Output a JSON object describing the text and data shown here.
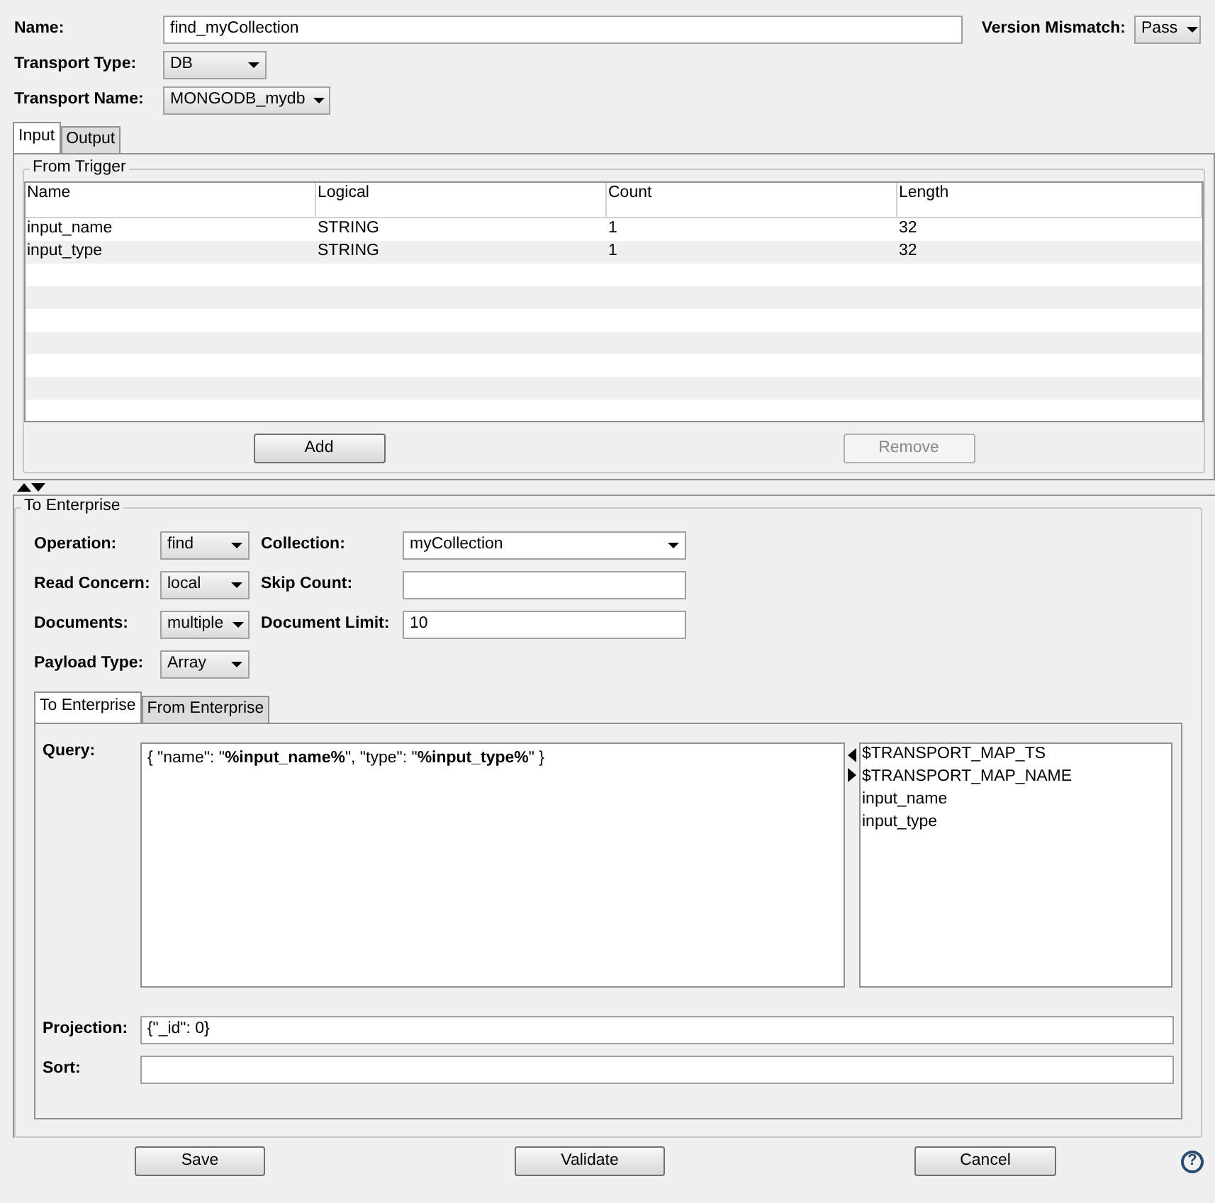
{
  "header_fields": [
    {
      "label": "Name:",
      "kind": "text",
      "value": "find_myCollection"
    },
    {
      "label": "Transport Type:",
      "kind": "dropdown",
      "value": "DB"
    },
    {
      "label": "Transport Name:",
      "kind": "dropdown",
      "value": "MONGODB_mydb"
    }
  ],
  "version_mismatch": {
    "label": "Version Mismatch:",
    "value": "Pass"
  },
  "tabs": [
    {
      "label": "Input",
      "selected": true
    },
    {
      "label": "Output",
      "selected": false
    }
  ],
  "from_trigger": {
    "title": "From Trigger",
    "table": {
      "columns": [
        "Name",
        "Logical",
        "Count",
        "Length"
      ],
      "rows": [
        [
          "input_name",
          "STRING",
          "1",
          "32"
        ],
        [
          "input_type",
          "STRING",
          "1",
          "32"
        ]
      ]
    },
    "buttons": [
      {
        "label": "Add",
        "disabled": false
      },
      {
        "label": "Remove",
        "disabled": true
      }
    ]
  },
  "to_enterprise": {
    "title": "To Enterprise",
    "left_fields": [
      {
        "label": "Operation:",
        "kind": "dropdown",
        "value": "find"
      },
      {
        "label": "Read Concern:",
        "kind": "dropdown",
        "value": "local"
      },
      {
        "label": "Documents:",
        "kind": "dropdown",
        "value": "multiple"
      },
      {
        "label": "Payload Type:",
        "kind": "dropdown",
        "value": "Array"
      }
    ],
    "right_fields": [
      {
        "label": "Collection:",
        "kind": "combo",
        "value": "myCollection"
      },
      {
        "label": "Skip Count:",
        "kind": "text"
      },
      {
        "label": "Document Limit:",
        "kind": "text",
        "value": "10"
      }
    ],
    "tabs": [
      {
        "label": "To Enterprise",
        "selected": true
      },
      {
        "label": "From Enterprise",
        "selected": false
      }
    ],
    "query": {
      "label": "Query:",
      "value": "{ \"name\": \"**%input_name%**\", \"type\": \"**%input_type%**\" }"
    },
    "variables": [
      "$TRANSPORT_MAP_TS",
      "$TRANSPORT_MAP_NAME",
      "input_name",
      "input_type"
    ],
    "projection": {
      "label": "Projection:",
      "value": "{\"_id\": 0}"
    },
    "sort": {
      "label": "Sort:"
    }
  },
  "buttons": [
    {
      "label": "Save",
      "disabled": false
    },
    {
      "label": "Validate",
      "disabled": false
    },
    {
      "label": "Cancel",
      "disabled": false
    }
  ],
  "help": "?"
}
